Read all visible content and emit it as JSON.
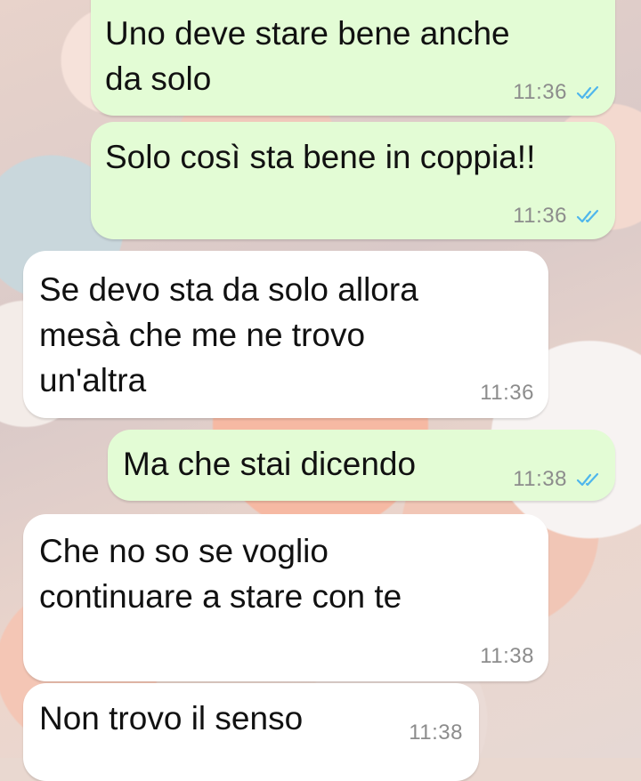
{
  "conversation": {
    "messages": [
      {
        "direction": "outgoing",
        "text": "Uno deve stare bene anche\nda solo",
        "time": "11:36",
        "status": "read",
        "status_icon": "double-check-icon"
      },
      {
        "direction": "outgoing",
        "text": "Solo così sta bene in coppia!!",
        "time": "11:36",
        "status": "read",
        "status_icon": "double-check-icon"
      },
      {
        "direction": "incoming",
        "text": "Se devo sta da solo allora\nmesà che me ne trovo\nun'altra",
        "time": "11:36"
      },
      {
        "direction": "outgoing",
        "text": "Ma che stai dicendo",
        "time": "11:38",
        "status": "read",
        "status_icon": "double-check-icon"
      },
      {
        "direction": "incoming",
        "text": "Che no so se voglio\ncontinuare a stare con te",
        "time": "11:38"
      },
      {
        "direction": "incoming",
        "text": "Non trovo il senso",
        "time": "11:38"
      }
    ]
  },
  "colors": {
    "outgoing_bubble": "#e3fcd5",
    "incoming_bubble": "#ffffff",
    "read_tick": "#4fb6ec",
    "timestamp": "#8c8c8c"
  }
}
